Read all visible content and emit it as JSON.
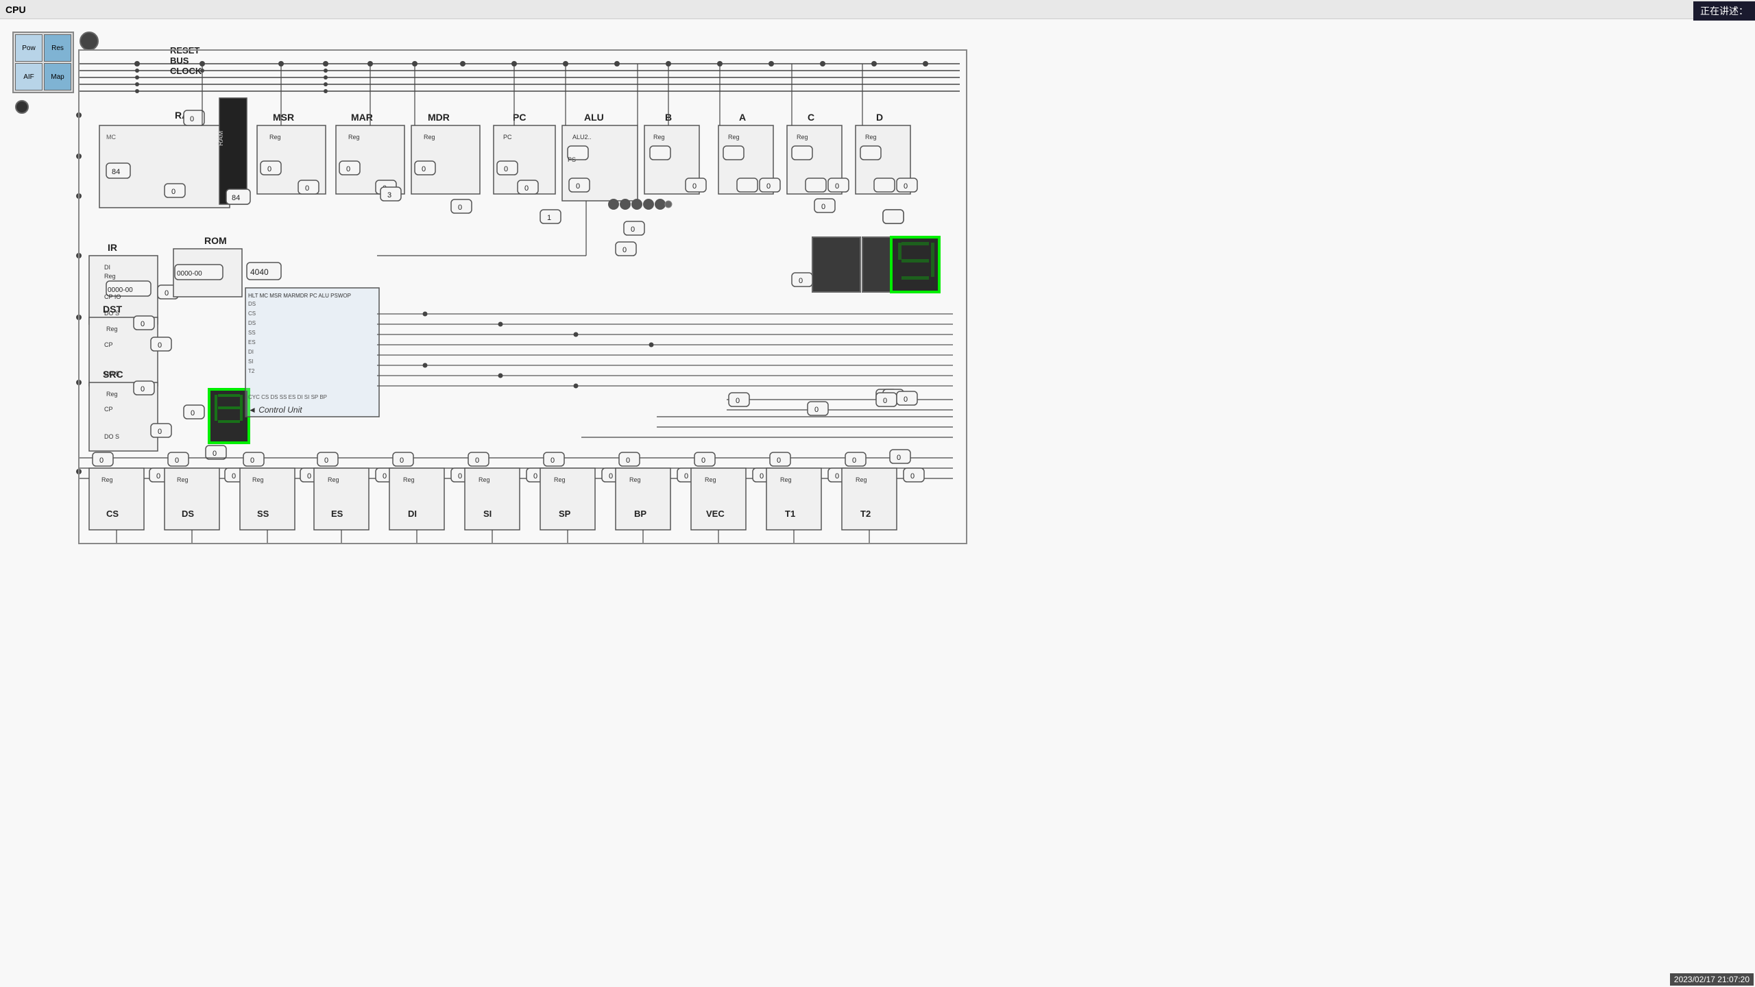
{
  "title": "CPU",
  "topRightText": "正在讲述：",
  "timestamp": "2023/02/17 21:07:20",
  "controls": {
    "pow": "Pow",
    "res": "Res",
    "aif": "AIF",
    "map": "Map"
  },
  "components": {
    "reset": "RESET",
    "bus": "BUS",
    "clock": "CLOCK",
    "ram": "RAM",
    "msr": "MSR",
    "mar": "MAR",
    "mdr": "MDR",
    "pc": "PC",
    "alu": "ALU",
    "b": "B",
    "a": "A",
    "c": "C",
    "d": "D",
    "ir": "IR",
    "rom": "ROM",
    "dst": "DST",
    "src": "SRC",
    "controlUnit": "Control Unit",
    "cs": "CS",
    "ds": "DS",
    "ss": "SS",
    "es": "ES",
    "di": "DI",
    "si": "SI",
    "sp": "SP",
    "bp": "BP",
    "vec": "VEC",
    "t1": "T1",
    "t2": "T2"
  },
  "values": {
    "ram84": "84",
    "ram84b": "84",
    "ramAddr": "0",
    "ramMC": "0",
    "msr0": "0",
    "mar0a": "0",
    "mar0b": "0",
    "mdr3": "3",
    "mdr0a": "0",
    "mdr0b": "0",
    "pc0a": "0",
    "pc0b": "0",
    "pc1": "1",
    "alu0a": "0",
    "alu0b": "0",
    "alu0c": "0",
    "b0a": "0",
    "b0b": "0",
    "a0a": "0",
    "a0b": "0",
    "c0a": "0",
    "c0b": "0",
    "c0c": "0",
    "d0a": "0",
    "d0b": "0",
    "d0c": "0",
    "irCode": "0000-00",
    "romCode": "4040",
    "dst0a": "0",
    "dst0b": "0",
    "src0a": "0",
    "src0b": "0",
    "src0c": "0"
  },
  "controlUnitHeader": "HLT MC MSR MARMDR PC  ALU PSWOP",
  "romLabel": "ROM",
  "regLabel": "Reg"
}
